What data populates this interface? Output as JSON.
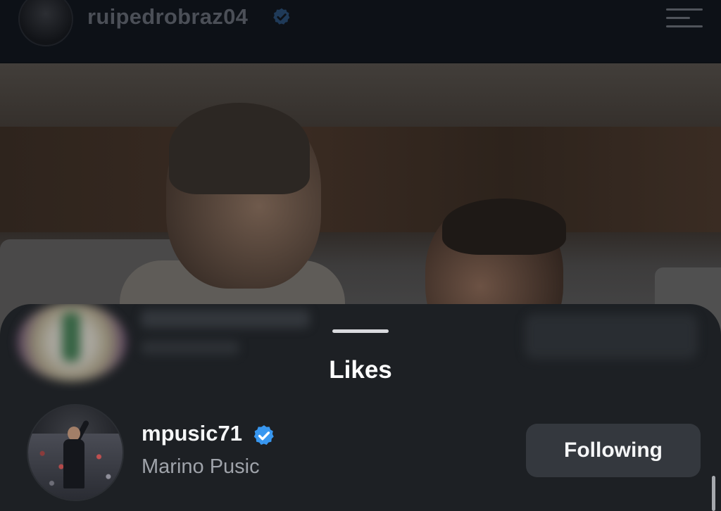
{
  "profile_header": {
    "username": "ruipedrobraz04",
    "verified_icon": "verified-badge-icon",
    "menu_icon": "hamburger-menu-icon"
  },
  "likes_sheet": {
    "title": "Likes",
    "grabber_icon": "sheet-grabber-handle",
    "items": [
      {
        "username": "mpusic71",
        "full_name": "Marino Pusic",
        "verified": true,
        "button_label": "Following"
      }
    ]
  },
  "colors": {
    "verified_blue": "#3897f0",
    "background": "#0c0f14",
    "sheet_background": "#1d2024",
    "button_background": "#34383e",
    "secondary_text": "#9fa3aa"
  }
}
